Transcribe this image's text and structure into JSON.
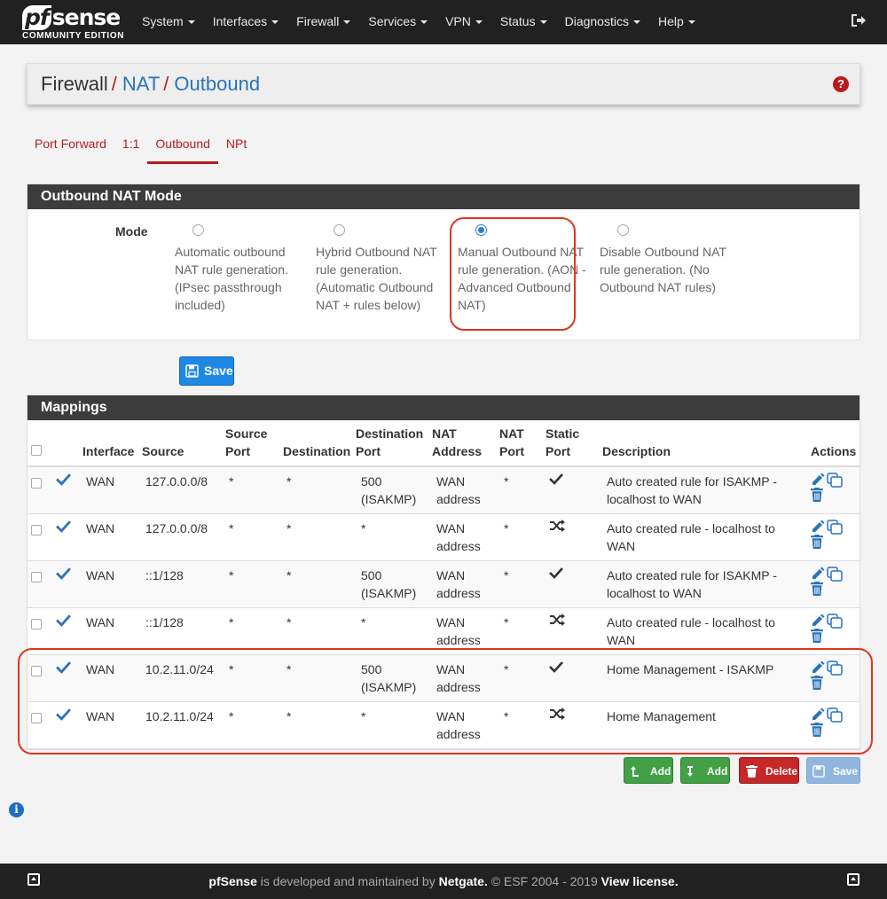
{
  "brand": {
    "logo_text": "sense",
    "logo_prefix": "pf",
    "edition": "COMMUNITY EDITION"
  },
  "nav": [
    "System",
    "Interfaces",
    "Firewall",
    "Services",
    "VPN",
    "Status",
    "Diagnostics",
    "Help"
  ],
  "breadcrumb": {
    "first": "Firewall",
    "second": "NAT",
    "third": "Outbound"
  },
  "tabs": [
    "Port Forward",
    "1:1",
    "Outbound",
    "NPt"
  ],
  "active_tab": "Outbound",
  "mode_panel": {
    "title": "Outbound NAT Mode",
    "label": "Mode",
    "options": [
      {
        "text": "Automatic outbound NAT rule generation. (IPsec passthrough included)",
        "checked": false
      },
      {
        "text": "Hybrid Outbound NAT rule generation. (Automatic Outbound NAT + rules below)",
        "checked": false
      },
      {
        "text": "Manual Outbound NAT rule generation. (AON - Advanced Outbound NAT)",
        "checked": true
      },
      {
        "text": "Disable Outbound NAT rule generation. (No Outbound NAT rules)",
        "checked": false
      }
    ],
    "save_label": "Save"
  },
  "mappings": {
    "title": "Mappings",
    "headers": {
      "interface": "Interface",
      "source": "Source",
      "source_port": "Source Port",
      "destination": "Destination",
      "destination_port": "Destination Port",
      "nat_address": "NAT Address",
      "nat_port": "NAT Port",
      "static_port": "Static Port",
      "description": "Description",
      "actions": "Actions"
    },
    "rows": [
      {
        "interface": "WAN",
        "source": "127.0.0.0/8",
        "source_port": "*",
        "destination": "*",
        "destination_port": "500 (ISAKMP)",
        "nat_address": "WAN address",
        "nat_port": "*",
        "static_port": "check",
        "description": "Auto created rule for ISAKMP - localhost to WAN"
      },
      {
        "interface": "WAN",
        "source": "127.0.0.0/8",
        "source_port": "*",
        "destination": "*",
        "destination_port": "*",
        "nat_address": "WAN address",
        "nat_port": "*",
        "static_port": "shuffle",
        "description": "Auto created rule - localhost to WAN"
      },
      {
        "interface": "WAN",
        "source": "::1/128",
        "source_port": "*",
        "destination": "*",
        "destination_port": "500 (ISAKMP)",
        "nat_address": "WAN address",
        "nat_port": "*",
        "static_port": "check",
        "description": "Auto created rule for ISAKMP - localhost to WAN"
      },
      {
        "interface": "WAN",
        "source": "::1/128",
        "source_port": "*",
        "destination": "*",
        "destination_port": "*",
        "nat_address": "WAN address",
        "nat_port": "*",
        "static_port": "shuffle",
        "description": "Auto created rule - localhost to WAN"
      },
      {
        "interface": "WAN",
        "source": "10.2.11.0/24",
        "source_port": "*",
        "destination": "*",
        "destination_port": "500 (ISAKMP)",
        "nat_address": "WAN address",
        "nat_port": "*",
        "static_port": "check",
        "description": "Home Management - ISAKMP"
      },
      {
        "interface": "WAN",
        "source": "10.2.11.0/24",
        "source_port": "*",
        "destination": "*",
        "destination_port": "*",
        "nat_address": "WAN address",
        "nat_port": "*",
        "static_port": "shuffle",
        "description": "Home Management"
      }
    ]
  },
  "buttons": {
    "add_top": "Add",
    "add_bottom": "Add",
    "delete": "Delete",
    "save": "Save"
  },
  "footer": {
    "brand": "pfSense",
    "text1": " is developed and maintained by ",
    "company": "Netgate.",
    "text2": " © ESF 2004 - 2019 ",
    "license": "View license."
  },
  "colors": {
    "accent_red": "#b71c1c",
    "link_blue": "#2a74b8",
    "nav_bg": "#212121",
    "panel_heading": "#3c3c3c",
    "highlight": "#e0341f"
  }
}
